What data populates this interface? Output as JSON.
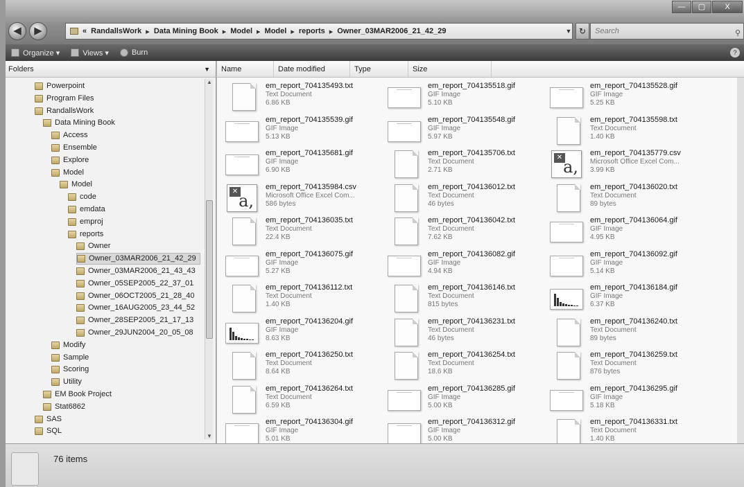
{
  "window": {
    "controls": [
      "—",
      "▢",
      "X"
    ]
  },
  "nav": {
    "back_glyph": "◀",
    "forward_glyph": "▶",
    "breadcrumb": [
      "«",
      "RandallsWork",
      "Data Mining Book",
      "Model",
      "Model",
      "reports",
      "Owner_03MAR2006_21_42_29"
    ],
    "separator": "▸",
    "search_placeholder": "Search"
  },
  "toolbar": {
    "organize": "Organize ▾",
    "views": "Views ▾",
    "burn": "Burn"
  },
  "folders": {
    "header": "Folders",
    "items": [
      {
        "label": "Powerpoint",
        "level": 0
      },
      {
        "label": "Program Files",
        "level": 0
      },
      {
        "label": "RandallsWork",
        "level": 0
      },
      {
        "label": "Data Mining Book",
        "level": 1
      },
      {
        "label": "Access",
        "level": 2
      },
      {
        "label": "Ensemble",
        "level": 2
      },
      {
        "label": "Explore",
        "level": 2
      },
      {
        "label": "Model",
        "level": 2
      },
      {
        "label": "Model",
        "level": 3
      },
      {
        "label": "code",
        "level": 4
      },
      {
        "label": "emdata",
        "level": 4
      },
      {
        "label": "emproj",
        "level": 4
      },
      {
        "label": "reports",
        "level": 4
      },
      {
        "label": "Owner",
        "level": 5
      },
      {
        "label": "Owner_03MAR2006_21_42_29",
        "level": 5,
        "selected": true
      },
      {
        "label": "Owner_03MAR2006_21_43_43",
        "level": 5
      },
      {
        "label": "Owner_05SEP2005_22_37_01",
        "level": 5
      },
      {
        "label": "Owner_06OCT2005_21_28_40",
        "level": 5
      },
      {
        "label": "Owner_16AUG2005_23_44_52",
        "level": 5
      },
      {
        "label": "Owner_28SEP2005_21_17_13",
        "level": 5
      },
      {
        "label": "Owner_29JUN2004_20_05_08",
        "level": 5
      },
      {
        "label": "Modify",
        "level": 2
      },
      {
        "label": "Sample",
        "level": 2
      },
      {
        "label": "Scoring",
        "level": 2
      },
      {
        "label": "Utility",
        "level": 2
      },
      {
        "label": "EM Book Project",
        "level": 1
      },
      {
        "label": "Stat6862",
        "level": 1
      },
      {
        "label": "SAS",
        "level": 0
      },
      {
        "label": "SQL",
        "level": 0
      }
    ]
  },
  "columns": [
    "Name",
    "Date modified",
    "Type",
    "Size"
  ],
  "files": [
    {
      "name": "em_report_704135493.txt",
      "type": "Text Document",
      "size": "6.86 KB",
      "icon": "txt"
    },
    {
      "name": "em_report_704135518.gif",
      "type": "GIF Image",
      "size": "5.10 KB",
      "icon": "gif"
    },
    {
      "name": "em_report_704135528.gif",
      "type": "GIF Image",
      "size": "5.25 KB",
      "icon": "gif"
    },
    {
      "name": "em_report_704135539.gif",
      "type": "GIF Image",
      "size": "5.13 KB",
      "icon": "gif"
    },
    {
      "name": "em_report_704135548.gif",
      "type": "GIF Image",
      "size": "5.97 KB",
      "icon": "gif"
    },
    {
      "name": "em_report_704135598.txt",
      "type": "Text Document",
      "size": "1.40 KB",
      "icon": "txt"
    },
    {
      "name": "em_report_704135681.gif",
      "type": "GIF Image",
      "size": "6.90 KB",
      "icon": "gif"
    },
    {
      "name": "em_report_704135706.txt",
      "type": "Text Document",
      "size": "2.71 KB",
      "icon": "txt"
    },
    {
      "name": "em_report_704135779.csv",
      "type": "Microsoft Office Excel Com...",
      "size": "3.99 KB",
      "icon": "csv"
    },
    {
      "name": "em_report_704135984.csv",
      "type": "Microsoft Office Excel Com...",
      "size": "586 bytes",
      "icon": "csv"
    },
    {
      "name": "em_report_704136012.txt",
      "type": "Text Document",
      "size": "46 bytes",
      "icon": "txt"
    },
    {
      "name": "em_report_704136020.txt",
      "type": "Text Document",
      "size": "89 bytes",
      "icon": "txt"
    },
    {
      "name": "em_report_704136035.txt",
      "type": "Text Document",
      "size": "22.4 KB",
      "icon": "txt"
    },
    {
      "name": "em_report_704136042.txt",
      "type": "Text Document",
      "size": "7.62 KB",
      "icon": "txt"
    },
    {
      "name": "em_report_704136064.gif",
      "type": "GIF Image",
      "size": "4.95 KB",
      "icon": "gif"
    },
    {
      "name": "em_report_704136075.gif",
      "type": "GIF Image",
      "size": "5.27 KB",
      "icon": "gif"
    },
    {
      "name": "em_report_704136082.gif",
      "type": "GIF Image",
      "size": "4.94 KB",
      "icon": "gif"
    },
    {
      "name": "em_report_704136092.gif",
      "type": "GIF Image",
      "size": "5.14 KB",
      "icon": "gif"
    },
    {
      "name": "em_report_704136112.txt",
      "type": "Text Document",
      "size": "1.40 KB",
      "icon": "txt"
    },
    {
      "name": "em_report_704136146.txt",
      "type": "Text Document",
      "size": "815 bytes",
      "icon": "txt"
    },
    {
      "name": "em_report_704136184.gif",
      "type": "GIF Image",
      "size": "6.37 KB",
      "icon": "chart"
    },
    {
      "name": "em_report_704136204.gif",
      "type": "GIF Image",
      "size": "8.63 KB",
      "icon": "chart"
    },
    {
      "name": "em_report_704136231.txt",
      "type": "Text Document",
      "size": "46 bytes",
      "icon": "txt"
    },
    {
      "name": "em_report_704136240.txt",
      "type": "Text Document",
      "size": "89 bytes",
      "icon": "txt"
    },
    {
      "name": "em_report_704136250.txt",
      "type": "Text Document",
      "size": "8.64 KB",
      "icon": "txt"
    },
    {
      "name": "em_report_704136254.txt",
      "type": "Text Document",
      "size": "18.6 KB",
      "icon": "txt"
    },
    {
      "name": "em_report_704136259.txt",
      "type": "Text Document",
      "size": "876 bytes",
      "icon": "txt"
    },
    {
      "name": "em_report_704136264.txt",
      "type": "Text Document",
      "size": "6.59 KB",
      "icon": "txt"
    },
    {
      "name": "em_report_704136285.gif",
      "type": "GIF Image",
      "size": "5.00 KB",
      "icon": "gif"
    },
    {
      "name": "em_report_704136295.gif",
      "type": "GIF Image",
      "size": "5.18 KB",
      "icon": "gif"
    },
    {
      "name": "em_report_704136304.gif",
      "type": "GIF Image",
      "size": "5.01 KB",
      "icon": "gif"
    },
    {
      "name": "em_report_704136312.gif",
      "type": "GIF Image",
      "size": "5.00 KB",
      "icon": "gif"
    },
    {
      "name": "em_report_704136331.txt",
      "type": "Text Document",
      "size": "1.40 KB",
      "icon": "txt"
    }
  ],
  "status": {
    "item_count": "76 items"
  }
}
